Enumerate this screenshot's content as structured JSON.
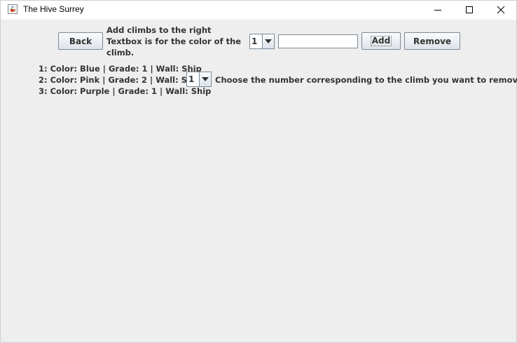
{
  "window": {
    "title": "The Hive Surrey",
    "icon": "java-cup-icon",
    "controls": [
      "minimize-icon",
      "maximize-icon",
      "close-icon"
    ]
  },
  "toolbar": {
    "back_label": "Back",
    "instructions": [
      "Add climbs to the right",
      "Textbox is for the color of the",
      "climb."
    ],
    "grade_selected": "1",
    "color_value": "",
    "add_label": "Add",
    "remove_label": "Remove"
  },
  "climbs": [
    "1: Color: Blue | Grade: 1 | Wall: Ship",
    "2: Color: Pink | Grade: 2 | Wall: Ship",
    "3: Color: Purple | Grade: 1 | Wall: Ship"
  ],
  "remove_section": {
    "selected": "1",
    "hint": "Choose the number corresponding to the climb you want to remove"
  }
}
